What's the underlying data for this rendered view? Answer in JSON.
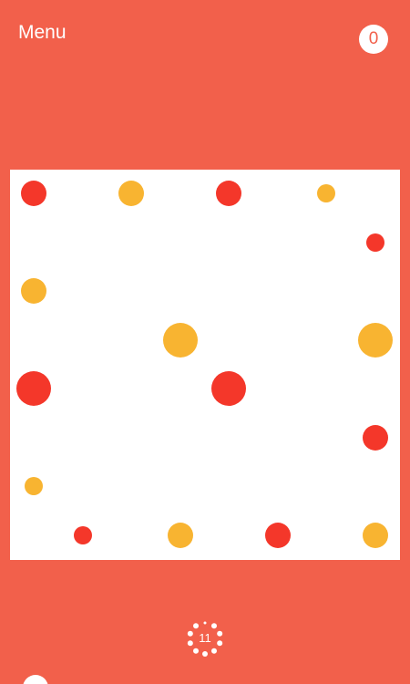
{
  "header": {
    "menu_label": "Menu",
    "score": "0"
  },
  "colors": {
    "background": "#f2604b",
    "board": "#ffffff",
    "dot_red": "#f4372a",
    "dot_yellow": "#f8b431",
    "score_text": "#f2604b"
  },
  "board": {
    "grid_size": 8,
    "dots": [
      {
        "col": 0,
        "row": 0,
        "color": "red",
        "size": "medium"
      },
      {
        "col": 2,
        "row": 0,
        "color": "yellow",
        "size": "medium"
      },
      {
        "col": 4,
        "row": 0,
        "color": "red",
        "size": "medium"
      },
      {
        "col": 6,
        "row": 0,
        "color": "yellow",
        "size": "small"
      },
      {
        "col": 7,
        "row": 1,
        "color": "red",
        "size": "small"
      },
      {
        "col": 0,
        "row": 2,
        "color": "yellow",
        "size": "medium"
      },
      {
        "col": 3,
        "row": 3,
        "color": "yellow",
        "size": "large"
      },
      {
        "col": 7,
        "row": 3,
        "color": "yellow",
        "size": "large"
      },
      {
        "col": 0,
        "row": 4,
        "color": "red",
        "size": "large"
      },
      {
        "col": 4,
        "row": 4,
        "color": "red",
        "size": "large"
      },
      {
        "col": 7,
        "row": 5,
        "color": "red",
        "size": "medium"
      },
      {
        "col": 0,
        "row": 6,
        "color": "yellow",
        "size": "small"
      },
      {
        "col": 1,
        "row": 7,
        "color": "red",
        "size": "small"
      },
      {
        "col": 3,
        "row": 7,
        "color": "yellow",
        "size": "medium"
      },
      {
        "col": 5,
        "row": 7,
        "color": "red",
        "size": "medium"
      },
      {
        "col": 7,
        "row": 7,
        "color": "yellow",
        "size": "medium"
      }
    ]
  },
  "timer": {
    "value": "11",
    "icon": "timer-dots-icon"
  },
  "footer": {
    "icon": "circle-button-icon"
  }
}
